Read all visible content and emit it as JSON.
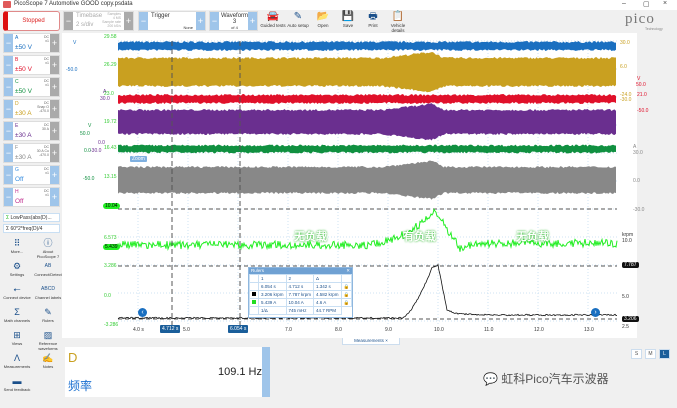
{
  "window": {
    "title": "PicoScope 7 Automotive GOOD copy.psdata",
    "minimize": "–",
    "maximize": "▢",
    "close": "×"
  },
  "toolbar": {
    "status": "Stopped",
    "timebase": {
      "label": "Timebase",
      "value": "2 s/div",
      "samples_label": "Samples",
      "samples": "4 MS",
      "rate_label": "Sample rate",
      "rate": "200 kS/s"
    },
    "trigger": {
      "label": "Trigger",
      "mode": "None"
    },
    "waveform": {
      "label": "Waveform",
      "value": "3",
      "of": "of 4"
    },
    "buttons": [
      {
        "label": "Guided tests",
        "icon": "car-icon"
      },
      {
        "label": "Auto setup",
        "icon": "wand-icon"
      },
      {
        "label": "Open",
        "icon": "folder-icon"
      },
      {
        "label": "Save",
        "icon": "save-icon"
      },
      {
        "label": "Print",
        "icon": "print-icon"
      },
      {
        "label": "Vehicle details",
        "icon": "clipboard-icon"
      }
    ],
    "logo": "pico",
    "logo_sub": "Technology"
  },
  "channels": [
    {
      "name": "A",
      "range": "±50 V",
      "coupling": "DC",
      "probe": "x1",
      "color": "#1a6fc0"
    },
    {
      "name": "B",
      "range": "±50 V",
      "coupling": "DC",
      "probe": "x1",
      "color": "#e0102a"
    },
    {
      "name": "C",
      "range": "±50 V",
      "coupling": "DC",
      "probe": "x1",
      "color": "#109040"
    },
    {
      "name": "D",
      "range": "±30 A",
      "coupling": "DC",
      "probe": "Snap O\n-470.0",
      "color": "#c9a020"
    },
    {
      "name": "E",
      "range": "±30 A",
      "coupling": "DC",
      "probe": "30 A",
      "color": "#6a2f8f"
    },
    {
      "name": "F",
      "range": "±30 A",
      "coupling": "DC",
      "probe": "30 A Cu\n-470.0",
      "color": "#888888"
    },
    {
      "name": "G",
      "range": "Off",
      "coupling": "DC",
      "probe": "x1",
      "color": "#3a8fe0"
    },
    {
      "name": "H",
      "range": "Off",
      "coupling": "DC",
      "probe": "x1",
      "color": "#c0308f"
    }
  ],
  "math_channels": [
    "LowPass(abs(D)...",
    "60*2*freq(D)/4"
  ],
  "tools": [
    {
      "label": "More...",
      "icon": "grid-icon"
    },
    {
      "label": "About PicoScope 7",
      "icon": "info-icon"
    },
    {
      "label": "Settings",
      "icon": "gear-icon"
    },
    {
      "label": "Connect/Detect",
      "icon": "ab-icon"
    },
    {
      "label": "Connect device",
      "icon": "usb-icon"
    },
    {
      "label": "Channel labels",
      "icon": "abcd-icon"
    },
    {
      "label": "Math channels",
      "icon": "sigma-icon"
    },
    {
      "label": "Rulers",
      "icon": "ruler-icon"
    },
    {
      "label": "Views",
      "icon": "views-icon"
    },
    {
      "label": "Reference waveforms",
      "icon": "reference-icon"
    },
    {
      "label": "Measurements",
      "icon": "measure-icon"
    },
    {
      "label": "Notes",
      "icon": "notes-icon"
    },
    {
      "label": "Send feedback",
      "icon": "feedback-icon"
    }
  ],
  "plot": {
    "left_axis": [
      {
        "t": "V",
        "c": "#1a6fc0"
      },
      {
        "t": "-50.0",
        "c": "#1a6fc0"
      },
      {
        "t": "A",
        "c": "#6a2f8f"
      },
      {
        "t": "30.0",
        "c": "#6a2f8f"
      },
      {
        "t": "V",
        "c": "#109040"
      },
      {
        "t": "50.0",
        "c": "#109040"
      },
      {
        "t": "0.0",
        "c": "#6a2f8f"
      },
      {
        "t": "0.0",
        "c": "#109040"
      },
      {
        "t": "-30.0",
        "c": "#6a2f8f"
      },
      {
        "t": "-50.0",
        "c": "#109040"
      }
    ],
    "green_axis": [
      "29.58",
      "26.29",
      "23.0",
      "19.72",
      "16.43",
      "13.15",
      "10.04",
      "6.573",
      "5.439",
      "3.286",
      "0.0",
      "-3.286"
    ],
    "right_axis": [
      {
        "t": "30.0",
        "c": "#c9a020"
      },
      {
        "t": "6.0",
        "c": "#c9a020"
      },
      {
        "t": "V",
        "c": "#e0102a"
      },
      {
        "t": "50.0",
        "c": "#e0102a"
      },
      {
        "t": "-24.0",
        "c": "#c9a020"
      },
      {
        "t": "-30.0",
        "c": "#c9a020"
      },
      {
        "t": "21.0",
        "c": "#e0102a"
      },
      {
        "t": "-50.0",
        "c": "#e0102a"
      },
      {
        "t": "A",
        "c": "#888"
      },
      {
        "t": "30.0",
        "c": "#888"
      },
      {
        "t": "0.0",
        "c": "#888"
      },
      {
        "t": "-30.0",
        "c": "#888"
      },
      {
        "t": "krpm",
        "c": "#333"
      },
      {
        "t": "10.0",
        "c": "#333"
      },
      {
        "t": "7.787",
        "c": "#fff"
      },
      {
        "t": "5.0",
        "c": "#333"
      },
      {
        "t": "3.206",
        "c": "#fff"
      },
      {
        "t": "2.5",
        "c": "#333"
      }
    ],
    "time_ticks": [
      "4.0 s",
      "5.0",
      "7.0",
      "8.0",
      "9.0",
      "10.0",
      "11.0",
      "12.0",
      "13.0"
    ],
    "cursor1": "4.712 s",
    "cursor2": "6.054 s",
    "annotations": [
      "无负载",
      "有负载",
      "无负载"
    ],
    "zoom_overview": "Zoom"
  },
  "rulers": {
    "title": "Rulers",
    "headers": [
      "1",
      "2",
      "Δ"
    ],
    "rows": [
      {
        "color": "",
        "v": [
          "6.054 s",
          "4.712 s",
          "1.342 s"
        ]
      },
      {
        "color": "#000000",
        "v": [
          "3.206 krpm",
          "7.787 krpm",
          "4.582 krpm"
        ]
      },
      {
        "color": "#22dd22",
        "v": [
          "5.439 A",
          "10.04 A",
          "4.6 A"
        ]
      }
    ],
    "freq": [
      "1/Δ",
      "745 mHz",
      "44.7 RPM"
    ]
  },
  "measurements": {
    "tab": "Measurements",
    "channel": "D",
    "name": "频率",
    "value": "109.1 Hz",
    "sizes": [
      "S",
      "M",
      "L"
    ]
  },
  "watermark": "虹科Pico汽车示波器"
}
